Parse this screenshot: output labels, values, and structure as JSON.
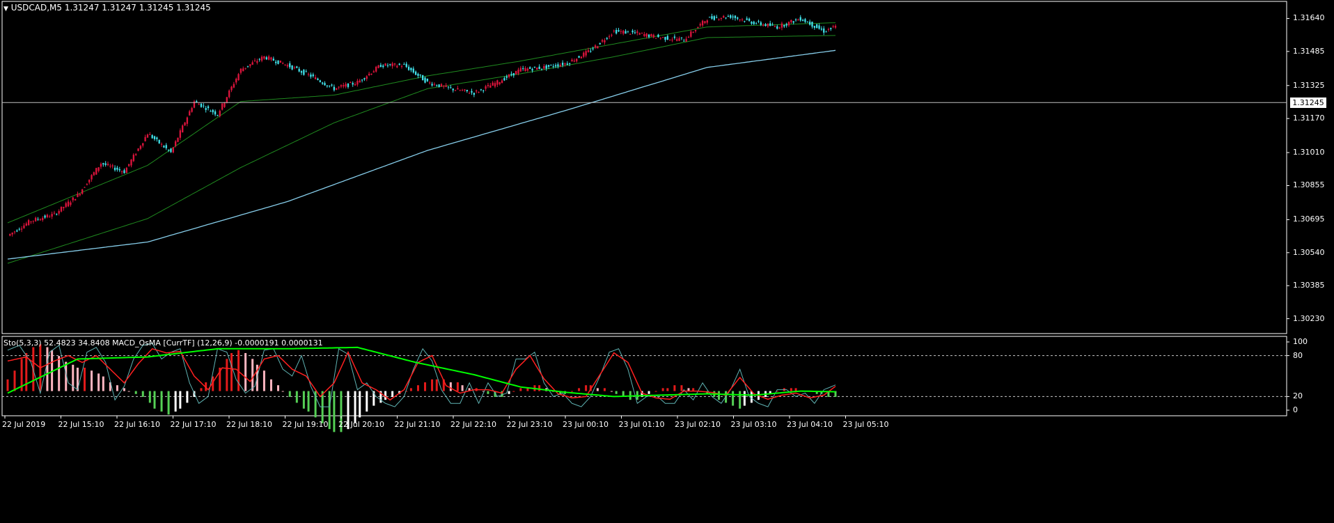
{
  "main": {
    "header_arrow": "▼",
    "header_text": "USDCAD,M5  1.31247 1.31247 1.31245 1.31245",
    "price_labels": [
      "1.31640",
      "1.31485",
      "1.31325",
      "1.31170",
      "1.31010",
      "1.30855",
      "1.30695",
      "1.30540",
      "1.30385",
      "1.30230"
    ],
    "current_price": "1.31245"
  },
  "indicator": {
    "header_text": "Sto(5,3,3) 52.4823 34.8408  MACD_OsMA [CurrTF] (12,26,9) -0.0000191 0.0000131",
    "levels": [
      "100",
      "80",
      "20",
      "0"
    ]
  },
  "time_labels": [
    "22 Jul 2019",
    "22 Jul 15:10",
    "22 Jul 16:10",
    "22 Jul 17:10",
    "22 Jul 18:10",
    "22 Jul 19:10",
    "22 Jul 20:10",
    "22 Jul 21:10",
    "22 Jul 22:10",
    "22 Jul 23:10",
    "23 Jul 00:10",
    "23 Jul 01:10",
    "23 Jul 02:10",
    "23 Jul 03:10",
    "23 Jul 04:10",
    "23 Jul 05:10"
  ],
  "colors": {
    "background": "#000000",
    "grid": "#ffffff",
    "bull_candle": "#dc143c",
    "bear_candle": "#40e0e8",
    "ma_line": "#87ceeb",
    "bands": "#1f8a1f",
    "stoch_main": "#5fb3b3",
    "stoch_signal": "#ff2020",
    "slow_line": "#00ff00",
    "osma_up_strong": "#e31b1b",
    "osma_up_weak": "#ffb6c1",
    "osma_down_strong": "#55d055",
    "osma_down_weak": "#ffffff"
  },
  "chart_data": [
    {
      "type": "candlestick",
      "symbol": "USDCAD",
      "timeframe": "M5",
      "ohlc_last": [
        1.31247,
        1.31247,
        1.31245,
        1.31245
      ],
      "ylim": [
        1.3016,
        1.3172
      ],
      "close_path": [
        [
          0,
          1.3062
        ],
        [
          10,
          1.3069
        ],
        [
          20,
          1.3072
        ],
        [
          30,
          1.3081
        ],
        [
          40,
          1.3096
        ],
        [
          50,
          1.3092
        ],
        [
          60,
          1.311
        ],
        [
          70,
          1.3101
        ],
        [
          80,
          1.3125
        ],
        [
          90,
          1.3119
        ],
        [
          100,
          1.314
        ],
        [
          110,
          1.3146
        ],
        [
          120,
          1.3142
        ],
        [
          130,
          1.3137
        ],
        [
          140,
          1.3131
        ],
        [
          150,
          1.3134
        ],
        [
          160,
          1.3142
        ],
        [
          170,
          1.3142
        ],
        [
          180,
          1.3134
        ],
        [
          190,
          1.3131
        ],
        [
          200,
          1.3129
        ],
        [
          210,
          1.3134
        ],
        [
          220,
          1.314
        ],
        [
          230,
          1.3141
        ],
        [
          240,
          1.3143
        ],
        [
          250,
          1.3149
        ],
        [
          260,
          1.3158
        ],
        [
          270,
          1.3157
        ],
        [
          280,
          1.3155
        ],
        [
          290,
          1.3154
        ],
        [
          300,
          1.3164
        ],
        [
          310,
          1.3165
        ],
        [
          320,
          1.3162
        ],
        [
          330,
          1.316
        ],
        [
          340,
          1.3164
        ],
        [
          350,
          1.3158
        ],
        [
          355,
          1.316
        ]
      ],
      "ma_path": [
        [
          0,
          1.3051
        ],
        [
          60,
          1.3059
        ],
        [
          120,
          1.3078
        ],
        [
          180,
          1.3102
        ],
        [
          240,
          1.3121
        ],
        [
          300,
          1.3141
        ],
        [
          355,
          1.3149
        ]
      ],
      "bands_upper": [
        [
          0,
          1.3068
        ],
        [
          60,
          1.3095
        ],
        [
          100,
          1.3125
        ],
        [
          140,
          1.3128
        ],
        [
          180,
          1.3137
        ],
        [
          220,
          1.3144
        ],
        [
          260,
          1.3152
        ],
        [
          300,
          1.316
        ],
        [
          355,
          1.3162
        ]
      ],
      "bands_lower": [
        [
          0,
          1.3049
        ],
        [
          60,
          1.307
        ],
        [
          100,
          1.3094
        ],
        [
          140,
          1.3115
        ],
        [
          180,
          1.3131
        ],
        [
          220,
          1.3138
        ],
        [
          260,
          1.3146
        ],
        [
          300,
          1.3155
        ],
        [
          355,
          1.3156
        ]
      ]
    },
    {
      "type": "oscillator",
      "ylim": [
        0,
        100
      ],
      "levels": [
        80,
        20
      ],
      "stoch_main": [
        [
          0,
          88
        ],
        [
          5,
          95
        ],
        [
          10,
          70
        ],
        [
          14,
          25
        ],
        [
          18,
          85
        ],
        [
          22,
          95
        ],
        [
          26,
          40
        ],
        [
          30,
          30
        ],
        [
          34,
          85
        ],
        [
          38,
          92
        ],
        [
          42,
          70
        ],
        [
          46,
          15
        ],
        [
          50,
          35
        ],
        [
          54,
          75
        ],
        [
          58,
          95
        ],
        [
          62,
          98
        ],
        [
          66,
          75
        ],
        [
          70,
          85
        ],
        [
          74,
          90
        ],
        [
          78,
          40
        ],
        [
          82,
          10
        ],
        [
          86,
          20
        ],
        [
          90,
          90
        ],
        [
          94,
          85
        ],
        [
          98,
          45
        ],
        [
          102,
          25
        ],
        [
          106,
          35
        ],
        [
          110,
          88
        ],
        [
          114,
          90
        ],
        [
          118,
          60
        ],
        [
          122,
          50
        ],
        [
          126,
          80
        ],
        [
          130,
          35
        ],
        [
          134,
          5
        ],
        [
          138,
          5
        ],
        [
          142,
          90
        ],
        [
          146,
          82
        ],
        [
          150,
          30
        ],
        [
          154,
          40
        ],
        [
          158,
          20
        ],
        [
          162,
          10
        ],
        [
          166,
          5
        ],
        [
          170,
          20
        ],
        [
          174,
          60
        ],
        [
          178,
          90
        ],
        [
          182,
          72
        ],
        [
          186,
          30
        ],
        [
          190,
          10
        ],
        [
          194,
          10
        ],
        [
          198,
          40
        ],
        [
          202,
          10
        ],
        [
          206,
          40
        ],
        [
          210,
          20
        ],
        [
          214,
          25
        ],
        [
          218,
          75
        ],
        [
          222,
          75
        ],
        [
          226,
          85
        ],
        [
          230,
          40
        ],
        [
          234,
          20
        ],
        [
          238,
          25
        ],
        [
          242,
          10
        ],
        [
          246,
          5
        ],
        [
          250,
          20
        ],
        [
          254,
          50
        ],
        [
          258,
          85
        ],
        [
          262,
          90
        ],
        [
          266,
          60
        ],
        [
          270,
          10
        ],
        [
          274,
          20
        ],
        [
          278,
          22
        ],
        [
          282,
          10
        ],
        [
          286,
          10
        ],
        [
          290,
          30
        ],
        [
          294,
          15
        ],
        [
          298,
          40
        ],
        [
          302,
          20
        ],
        [
          306,
          10
        ],
        [
          310,
          30
        ],
        [
          314,
          60
        ],
        [
          318,
          20
        ],
        [
          322,
          10
        ],
        [
          326,
          5
        ],
        [
          330,
          30
        ],
        [
          334,
          30
        ],
        [
          338,
          20
        ],
        [
          342,
          25
        ],
        [
          346,
          10
        ],
        [
          350,
          30
        ],
        [
          355,
          37
        ]
      ],
      "stoch_signal": [
        [
          0,
          72
        ],
        [
          8,
          78
        ],
        [
          14,
          62
        ],
        [
          20,
          72
        ],
        [
          26,
          80
        ],
        [
          32,
          70
        ],
        [
          38,
          80
        ],
        [
          44,
          60
        ],
        [
          50,
          40
        ],
        [
          56,
          68
        ],
        [
          62,
          90
        ],
        [
          68,
          84
        ],
        [
          74,
          86
        ],
        [
          80,
          50
        ],
        [
          86,
          30
        ],
        [
          92,
          62
        ],
        [
          98,
          60
        ],
        [
          104,
          42
        ],
        [
          110,
          75
        ],
        [
          116,
          80
        ],
        [
          122,
          60
        ],
        [
          128,
          50
        ],
        [
          134,
          20
        ],
        [
          140,
          40
        ],
        [
          146,
          85
        ],
        [
          152,
          40
        ],
        [
          158,
          30
        ],
        [
          164,
          15
        ],
        [
          170,
          30
        ],
        [
          176,
          70
        ],
        [
          182,
          80
        ],
        [
          188,
          36
        ],
        [
          194,
          25
        ],
        [
          200,
          30
        ],
        [
          206,
          30
        ],
        [
          212,
          25
        ],
        [
          218,
          60
        ],
        [
          224,
          80
        ],
        [
          230,
          46
        ],
        [
          236,
          24
        ],
        [
          242,
          18
        ],
        [
          248,
          20
        ],
        [
          254,
          52
        ],
        [
          260,
          84
        ],
        [
          266,
          70
        ],
        [
          272,
          25
        ],
        [
          278,
          18
        ],
        [
          284,
          16
        ],
        [
          290,
          28
        ],
        [
          296,
          28
        ],
        [
          302,
          26
        ],
        [
          308,
          22
        ],
        [
          314,
          48
        ],
        [
          320,
          24
        ],
        [
          326,
          16
        ],
        [
          332,
          22
        ],
        [
          338,
          25
        ],
        [
          344,
          18
        ],
        [
          350,
          22
        ],
        [
          355,
          35
        ]
      ],
      "slow_line": [
        [
          0,
          25
        ],
        [
          30,
          75
        ],
        [
          60,
          78
        ],
        [
          90,
          90
        ],
        [
          120,
          90
        ],
        [
          150,
          92
        ],
        [
          175,
          70
        ],
        [
          200,
          52
        ],
        [
          220,
          34
        ],
        [
          240,
          26
        ],
        [
          260,
          20
        ],
        [
          280,
          22
        ],
        [
          300,
          24
        ],
        [
          320,
          22
        ],
        [
          340,
          28
        ],
        [
          355,
          27
        ]
      ],
      "osma": [
        4,
        7,
        11,
        13,
        15,
        16,
        15,
        14,
        12,
        10,
        9,
        8,
        8,
        7,
        6,
        5,
        3,
        2,
        1,
        0,
        -1,
        -2,
        -4,
        -6,
        -7,
        -8,
        -7,
        -6,
        -4,
        -2,
        1,
        3,
        5,
        8,
        11,
        13,
        14,
        13,
        11,
        9,
        7,
        4,
        2,
        0,
        -2,
        -4,
        -6,
        -7,
        -9,
        -11,
        -13,
        -14,
        -14,
        -13,
        -11,
        -9,
        -7,
        -5,
        -4,
        -3,
        -2,
        -1,
        0,
        1,
        2,
        3,
        4,
        4,
        4,
        3,
        3,
        2,
        1,
        1,
        0,
        -1,
        -2,
        -2,
        -1,
        0,
        1,
        1,
        2,
        2,
        1,
        0,
        -1,
        -1,
        0,
        1,
        2,
        2,
        1,
        1,
        0,
        -1,
        -2,
        -3,
        -3,
        -2,
        -1,
        0,
        1,
        1,
        2,
        2,
        1,
        1,
        0,
        -1,
        -2,
        -3,
        -4,
        -5,
        -6,
        -5,
        -4,
        -3,
        -2,
        -1,
        0,
        1,
        1,
        1,
        0,
        0,
        -1,
        -1,
        -2,
        -2
      ]
    }
  ]
}
